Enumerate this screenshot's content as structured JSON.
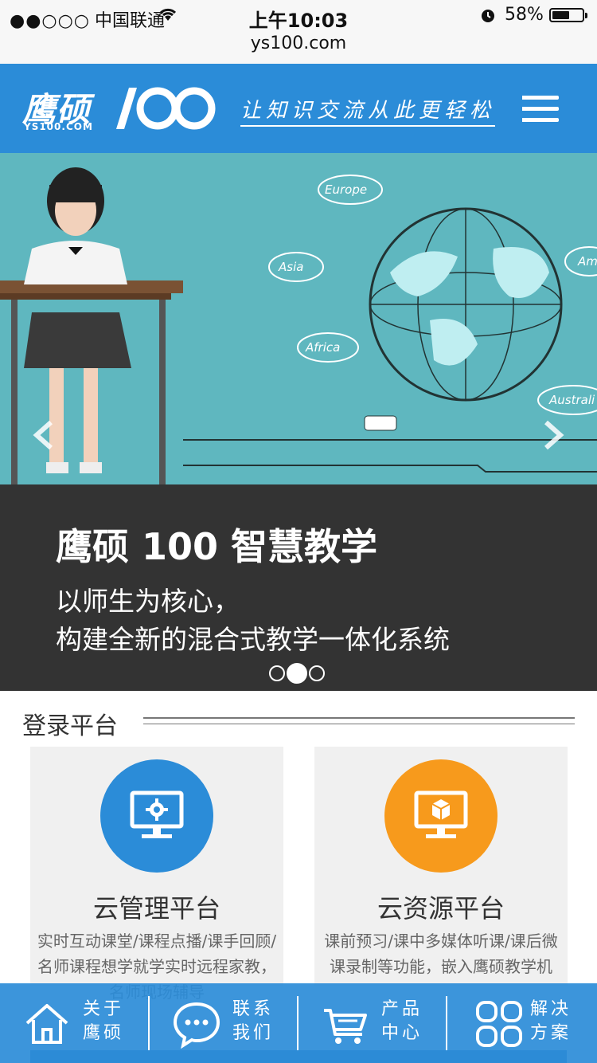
{
  "status_bar": {
    "signal": "●●○○○",
    "carrier": "中国联通",
    "time": "上午10:03",
    "battery": "58%",
    "battery_level": 0.58,
    "url": "ys100.com"
  },
  "header": {
    "logo_cn": "鹰硕",
    "logo_num": "100",
    "logo_en": "YS100.COM",
    "slogan": "让知识交流从此更轻松",
    "brand_color": "#2b8cd8"
  },
  "banner": {
    "caption_title": "鹰硕 100  智慧教学",
    "caption_line1": "以师生为核心，",
    "caption_line2": "构建全新的混合式教学一体化系统",
    "labels": [
      "Europe",
      "Asia",
      "Africa",
      "Am",
      "Australi"
    ],
    "slide_count": 3,
    "active_slide": 2
  },
  "login_section": {
    "title": "登录平台",
    "cards": [
      {
        "name": "云管理平台",
        "desc": "实时互动课堂/课程点播/课手回顾/名师课程想学就学实时远程家教，名师现场辅导",
        "icon": "monitor-gear-icon",
        "color": "#2b8cd8"
      },
      {
        "name": "云资源平台",
        "desc": "课前预习/课中多媒体听课/课后微课录制等功能，嵌入鹰硕教学机",
        "icon": "monitor-box-icon",
        "color": "#f79a1c"
      }
    ]
  },
  "bottom_nav": [
    {
      "label1": "关于",
      "label2": "鹰硕",
      "icon": "home-icon"
    },
    {
      "label1": "联系",
      "label2": "我们",
      "icon": "chat-icon"
    },
    {
      "label1": "产品",
      "label2": "中心",
      "icon": "cart-icon"
    },
    {
      "label1": "解决",
      "label2": "方案",
      "icon": "grid-icon"
    }
  ]
}
